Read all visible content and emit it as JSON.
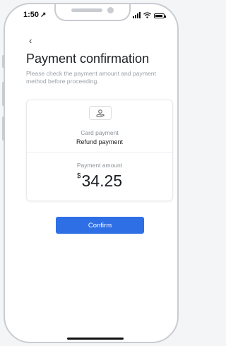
{
  "status_bar": {
    "time": "1:50",
    "location_arrow": "↗"
  },
  "header": {
    "back_glyph": "‹",
    "title": "Payment confirmation",
    "subtitle": "Please check the payment amount and payment method before proceeding."
  },
  "payment_card": {
    "method_icon": "hand-money-icon",
    "method_label": "Card payment",
    "method_value": "Refund payment",
    "amount_label": "Payment amount",
    "currency_symbol": "$",
    "amount": "34.25"
  },
  "actions": {
    "confirm_label": "Confirm"
  },
  "colors": {
    "primary": "#2f6fe6",
    "text_dark": "#1b1f24",
    "text_muted": "#9aa0a6"
  }
}
